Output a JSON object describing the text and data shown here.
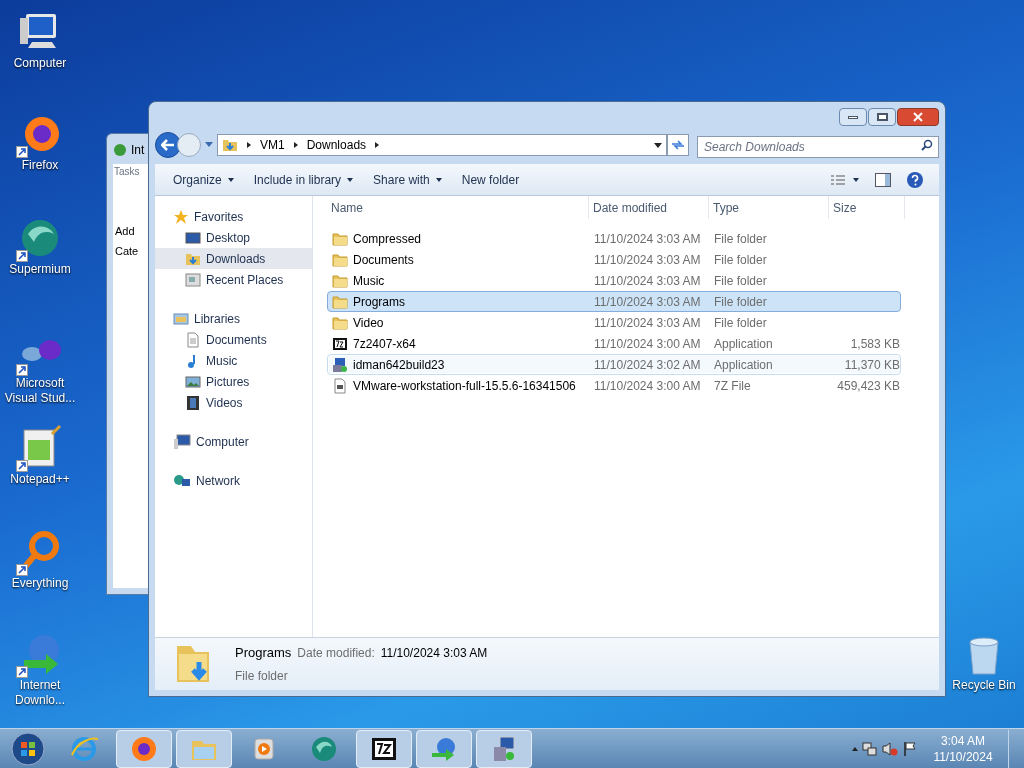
{
  "desktop_icons": [
    {
      "label": "Computer",
      "kind": "computer",
      "shortcut": false
    },
    {
      "label": "Firefox",
      "kind": "firefox",
      "shortcut": true
    },
    {
      "label": "Supermium",
      "kind": "supermium",
      "shortcut": true
    },
    {
      "label": "Microsoft Visual Stud...",
      "kind": "visualstudio",
      "shortcut": true
    },
    {
      "label": "Notepad++",
      "kind": "notepad",
      "shortcut": true
    },
    {
      "label": "Everything",
      "kind": "everything",
      "shortcut": true
    },
    {
      "label": "Internet Downlo...",
      "kind": "idm",
      "shortcut": true
    },
    {
      "label": "Recycle Bin",
      "kind": "recycle",
      "shortcut": false
    }
  ],
  "background_window": {
    "title": "Int",
    "tab": "Tasks",
    "button": "Add",
    "section": "Cate"
  },
  "explorer": {
    "breadcrumb": [
      "VM1",
      "Downloads"
    ],
    "search": {
      "placeholder": "Search Downloads"
    },
    "toolbar": [
      {
        "label": "Organize",
        "dropdown": true
      },
      {
        "label": "Include in library",
        "dropdown": true
      },
      {
        "label": "Share with",
        "dropdown": true
      },
      {
        "label": "New folder",
        "dropdown": false
      }
    ],
    "nav": [
      {
        "label": "Favorites",
        "kind": "star",
        "selected": false,
        "children": [
          {
            "label": "Desktop",
            "kind": "desktop",
            "selected": false
          },
          {
            "label": "Downloads",
            "kind": "downloads",
            "selected": true
          },
          {
            "label": "Recent Places",
            "kind": "recent",
            "selected": false
          }
        ]
      },
      {
        "label": "Libraries",
        "kind": "libraries",
        "selected": false,
        "children": [
          {
            "label": "Documents",
            "kind": "document",
            "selected": false
          },
          {
            "label": "Music",
            "kind": "music",
            "selected": false
          },
          {
            "label": "Pictures",
            "kind": "pictures",
            "selected": false
          },
          {
            "label": "Videos",
            "kind": "videos",
            "selected": false
          }
        ]
      },
      {
        "label": "Computer",
        "kind": "computer",
        "selected": false
      },
      {
        "label": "Network",
        "kind": "network",
        "selected": false
      }
    ],
    "columns": [
      "Name",
      "Date modified",
      "Type",
      "Size"
    ],
    "rows": [
      {
        "name": "Compressed",
        "date": "11/10/2024 3:03 AM",
        "type": "File folder",
        "size": "",
        "kind": "folder",
        "selected": false,
        "hovered": false
      },
      {
        "name": "Documents",
        "date": "11/10/2024 3:03 AM",
        "type": "File folder",
        "size": "",
        "kind": "folder",
        "selected": false,
        "hovered": false
      },
      {
        "name": "Music",
        "date": "11/10/2024 3:03 AM",
        "type": "File folder",
        "size": "",
        "kind": "folder",
        "selected": false,
        "hovered": false
      },
      {
        "name": "Programs",
        "date": "11/10/2024 3:03 AM",
        "type": "File folder",
        "size": "",
        "kind": "folder",
        "selected": true,
        "hovered": false
      },
      {
        "name": "Video",
        "date": "11/10/2024 3:03 AM",
        "type": "File folder",
        "size": "",
        "kind": "folder",
        "selected": false,
        "hovered": false
      },
      {
        "name": "7z2407-x64",
        "date": "11/10/2024 3:00 AM",
        "type": "Application",
        "size": "1,583 KB",
        "kind": "sevenzip",
        "selected": false,
        "hovered": false
      },
      {
        "name": "idman642build23",
        "date": "11/10/2024 3:02 AM",
        "type": "Application",
        "size": "11,370 KB",
        "kind": "installer",
        "selected": false,
        "hovered": true
      },
      {
        "name": "VMware-workstation-full-15.5.6-16341506",
        "date": "11/10/2024 3:00 AM",
        "type": "7Z File",
        "size": "459,423 KB",
        "kind": "archive",
        "selected": false,
        "hovered": false
      }
    ],
    "details": {
      "name": "Programs",
      "date_label": "Date modified:",
      "date": "11/10/2024 3:03 AM",
      "type": "File folder"
    }
  },
  "taskbar": {
    "items": [
      {
        "kind": "ie",
        "active": false
      },
      {
        "kind": "firefox",
        "active": true
      },
      {
        "kind": "explorer",
        "active": true
      },
      {
        "kind": "media",
        "active": false
      },
      {
        "kind": "supermium",
        "active": false
      },
      {
        "kind": "sevenzip",
        "active": true
      },
      {
        "kind": "idm",
        "active": true
      },
      {
        "kind": "installer",
        "active": true
      }
    ],
    "time": "3:04 AM",
    "date": "11/10/2024"
  }
}
